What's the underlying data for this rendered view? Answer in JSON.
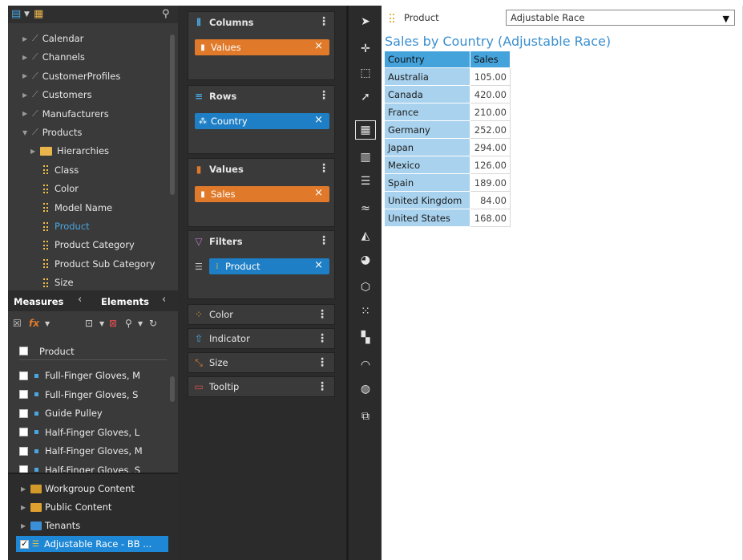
{
  "left_panel": {
    "tree": [
      {
        "label": "Calendar",
        "type": "dimension"
      },
      {
        "label": "Channels",
        "type": "dimension"
      },
      {
        "label": "CustomerProfiles",
        "type": "dimension"
      },
      {
        "label": "Customers",
        "type": "dimension"
      },
      {
        "label": "Manufacturers",
        "type": "dimension"
      },
      {
        "label": "Products",
        "type": "dimension",
        "expanded": true
      },
      {
        "label": "Hierarchies",
        "type": "folder"
      },
      {
        "label": "Class",
        "type": "field"
      },
      {
        "label": "Color",
        "type": "field"
      },
      {
        "label": "Model Name",
        "type": "field"
      },
      {
        "label": "Product",
        "type": "field",
        "selected": true
      },
      {
        "label": "Product Category",
        "type": "field"
      },
      {
        "label": "Product Sub Category",
        "type": "field"
      },
      {
        "label": "Size",
        "type": "field"
      }
    ],
    "tabs": {
      "measures": "Measures",
      "elements": "Elements"
    },
    "members_header": "Product",
    "members": [
      "Full-Finger Gloves, M",
      "Full-Finger Gloves, S",
      "Guide Pulley",
      "Half-Finger Gloves, L",
      "Half-Finger Gloves, M",
      "Half-Finger Gloves, S"
    ],
    "content_tree": [
      {
        "label": "Workgroup Content",
        "color": "#d19a2a"
      },
      {
        "label": "Public Content",
        "color": "#e0a030"
      },
      {
        "label": "Tenants",
        "color": "#3b8fd6"
      }
    ],
    "content_selected": "Adjustable Race - BB ..."
  },
  "wells": {
    "columns": {
      "title": "Columns",
      "pill": "Values"
    },
    "rows": {
      "title": "Rows",
      "pill": "Country"
    },
    "values": {
      "title": "Values",
      "pill": "Sales"
    },
    "filters": {
      "title": "Filters",
      "pill": "Product"
    },
    "color": "Color",
    "indicator": "Indicator",
    "size": "Size",
    "tooltip": "Tooltip"
  },
  "canvas": {
    "filter_label": "Product",
    "filter_value": "Adjustable Race",
    "title": "Sales by Country (Adjustable Race)",
    "table": {
      "headers": [
        "Country",
        "Sales"
      ],
      "rows": [
        [
          "Australia",
          "105.00"
        ],
        [
          "Canada",
          "420.00"
        ],
        [
          "France",
          "210.00"
        ],
        [
          "Germany",
          "252.00"
        ],
        [
          "Japan",
          "294.00"
        ],
        [
          "Mexico",
          "126.00"
        ],
        [
          "Spain",
          "189.00"
        ],
        [
          "United Kingdom",
          "84.00"
        ],
        [
          "United States",
          "168.00"
        ]
      ]
    }
  },
  "colors": {
    "accent_blue": "#1e7fc6",
    "accent_orange": "#e07a2a",
    "table_header": "#45a3dc",
    "table_row": "#a8d2ee"
  },
  "icons": [
    "pointer-icon",
    "add-point-icon",
    "select-region-icon",
    "cursor-icon",
    "grid-icon",
    "bar-chart-icon",
    "list-icon",
    "line-chart-icon",
    "area-chart-icon",
    "pie-chart-icon",
    "radar-chart-icon",
    "scatter-icon",
    "treemap-icon",
    "gauge-icon",
    "globe-icon",
    "custom-visual-icon"
  ]
}
